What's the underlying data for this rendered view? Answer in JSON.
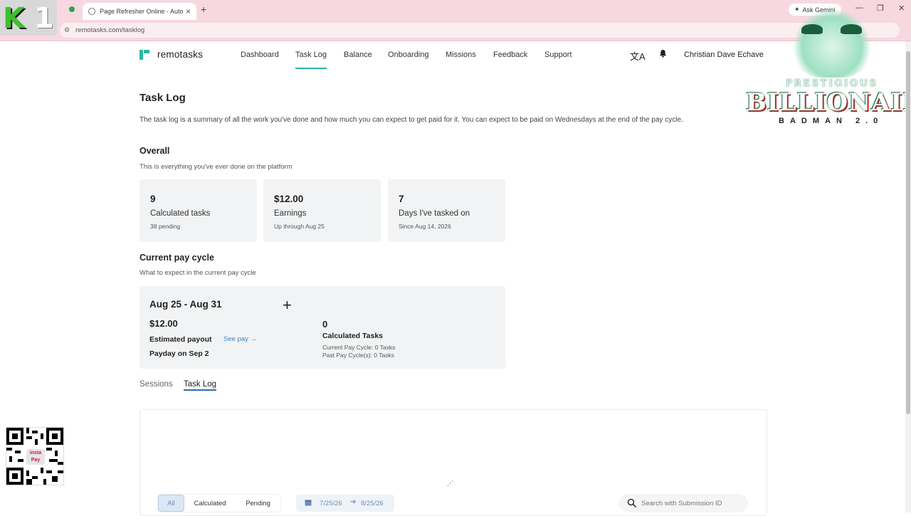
{
  "browser": {
    "tab_title": "Page Refresher Online - Auto R",
    "new_tab": "+",
    "ask_gemini": "Ask Gemini",
    "url": "remotasks.com/tasklog",
    "window_controls": [
      "—",
      "❐",
      "✕"
    ]
  },
  "overlays": {
    "k1_logo": {
      "k": "K",
      "one": "1"
    },
    "billionaire": {
      "line1": "PRESTIGIOUS",
      "line2": "BILLIONAIRE",
      "line3": "BADMAN 2.0"
    },
    "qr_label": "insta Pay"
  },
  "header": {
    "brand": "remotasks",
    "nav": [
      "Dashboard",
      "Task Log",
      "Balance",
      "Onboarding",
      "Missions",
      "Feedback",
      "Support"
    ],
    "active_nav": "Task Log",
    "user_name": "Christian Dave Echave"
  },
  "page": {
    "title": "Task Log",
    "description": "The task log is a summary of all the work you've done and how much you can expect to get paid for it. You can expect to be paid on Wednesdays at the end of the pay cycle."
  },
  "overall": {
    "title": "Overall",
    "subtitle": "This is everything you've ever done on the platform",
    "cards": [
      {
        "value": "9",
        "label": "Calculated tasks",
        "sub": "38 pending"
      },
      {
        "value": "$12.00",
        "label": "Earnings",
        "sub": "Up through Aug 25"
      },
      {
        "value": "7",
        "label": "Days I've tasked on",
        "sub": "Since Aug 14, 2026"
      }
    ]
  },
  "pay_cycle": {
    "title": "Current pay cycle",
    "subtitle": "What to expect in the current pay cycle",
    "range": "Aug 25 - Aug 31",
    "plus": "+",
    "payout_amount": "$12.00",
    "payout_label": "Estimated payout",
    "see_pay": "See pay →",
    "payday": "Payday on Sep 2",
    "calc_value": "0",
    "calc_label": "Calculated Tasks",
    "current_cycle": "Current Pay Cycle: 0 Tasks",
    "past_cycles": "Past Pay Cycle(s): 0 Tasks"
  },
  "subtabs": {
    "sessions": "Sessions",
    "task_log": "Task Log"
  },
  "filters": {
    "all": "All",
    "calculated": "Calculated",
    "pending": "Pending",
    "date_from": "7/25/26",
    "date_to": "8/25/26",
    "search_placeholder": "Search with Submission ID"
  },
  "colors": {
    "accent": "#2ab7a0",
    "link": "#3b82c4",
    "card_bg": "#f2f3f4",
    "tabbar_bg": "#f7d8e0"
  }
}
